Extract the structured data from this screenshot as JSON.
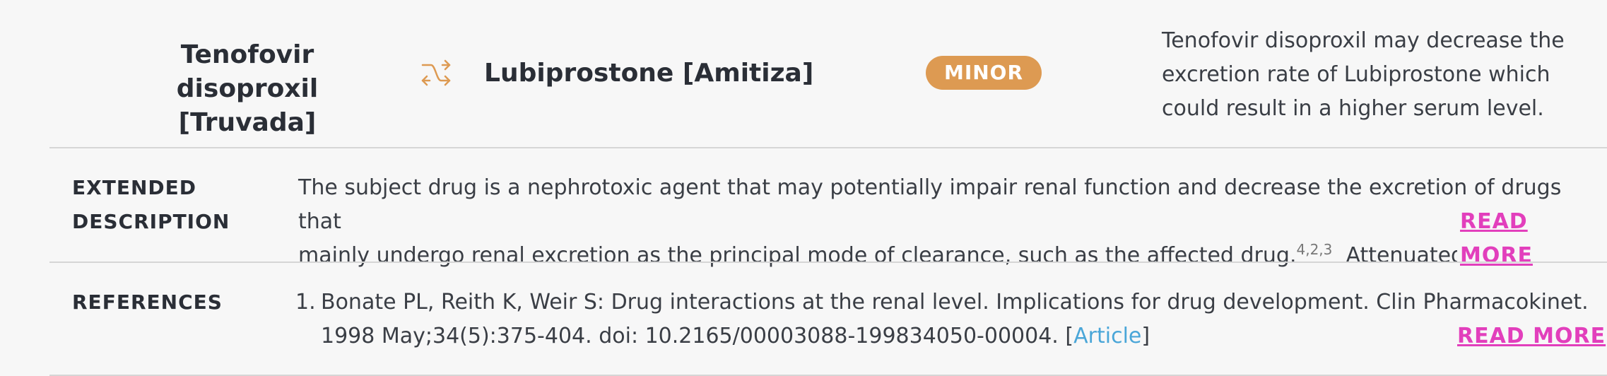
{
  "interaction": {
    "drug_a": "Tenofovir disoproxil [Truvada]",
    "drug_b": "Lubiprostone [Amitiza]",
    "swap_icon": "swap-arrows-icon",
    "severity": "MINOR",
    "severity_color": "#dd9a52",
    "summary": "Tenofovir disoproxil may decrease the excretion rate of Lubiprostone which could result in a higher serum level."
  },
  "extended": {
    "label_line1": "EXTENDED",
    "label_line2": "DESCRIPTION",
    "text_line1": "The subject drug is a nephrotoxic agent that may potentially impair renal function and decrease the excretion of drugs that",
    "text_line2": "mainly undergo renal excretion as the principal mode of clearance, such as the affected drug.",
    "citation": "4,2,3",
    "text_continued": "Attenuated re",
    "read_more": "READ MORE"
  },
  "references": {
    "label": "REFERENCES",
    "items": [
      {
        "number": "1.",
        "line1": "Bonate PL, Reith K, Weir S: Drug interactions at the renal level. Implications for drug development. Clin Pharmacokinet.",
        "line2": "1998 May;34(5):375-404. doi: 10.2165/00003088-199834050-00004.",
        "bracket_open": "[",
        "link_text": "Article",
        "bracket_close": "]"
      }
    ],
    "read_more": "READ MORE"
  },
  "colors": {
    "read_more": "#e23fbc",
    "link": "#4aa6d8",
    "background": "#f7f7f7"
  }
}
